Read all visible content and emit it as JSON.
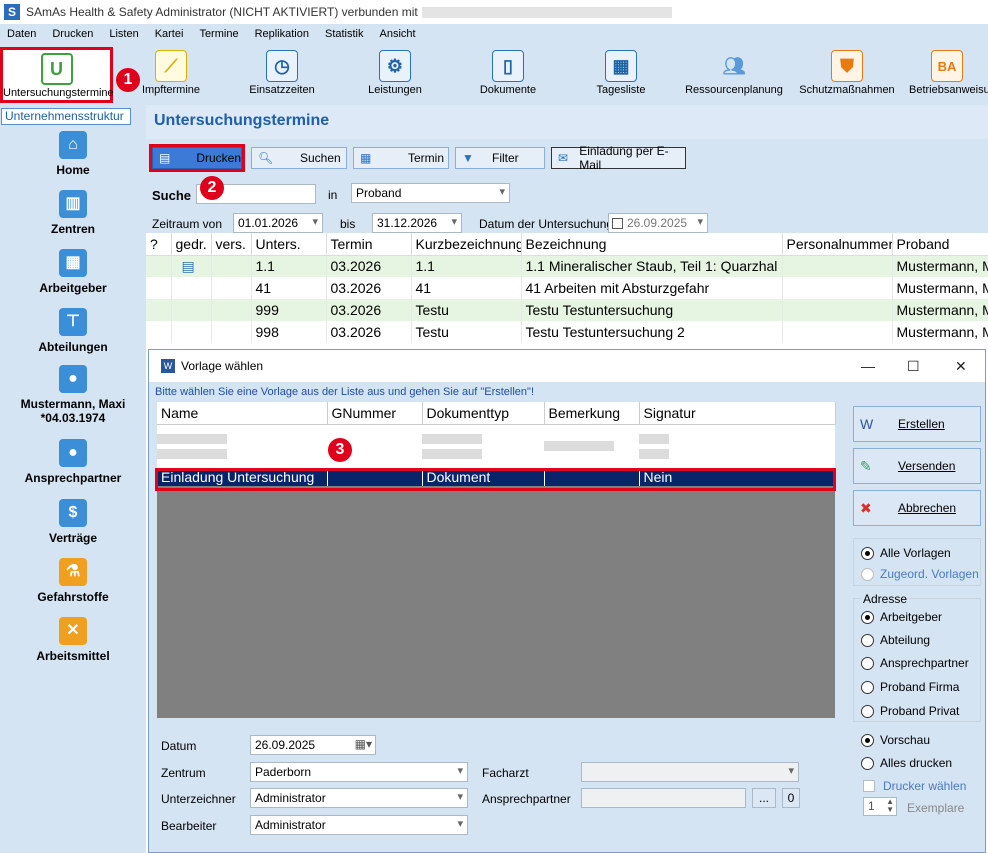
{
  "window": {
    "title": "SAmAs Health & Safety Administrator (NICHT AKTIVIERT)  verbunden mit",
    "app_icon": "S"
  },
  "menu": [
    "Daten",
    "Drucken",
    "Listen",
    "Kartei",
    "Termine",
    "Replikation",
    "Statistik",
    "Ansicht"
  ],
  "toolbar": [
    {
      "label": "Untersuchungstermine",
      "icon": "u-letter-icon"
    },
    {
      "label": "Impftermine",
      "icon": "syringe-icon"
    },
    {
      "label": "Einsatzzeiten",
      "icon": "calendar-clock-icon"
    },
    {
      "label": "Leistungen",
      "icon": "gear-clock-icon"
    },
    {
      "label": "Dokumente",
      "icon": "documents-icon"
    },
    {
      "label": "Tagesliste",
      "icon": "calendar-grid-icon"
    },
    {
      "label": "Ressourcenplanung",
      "icon": "people-icon"
    },
    {
      "label": "Schutzmaßnahmen",
      "icon": "helmet-shield-icon"
    },
    {
      "label": "Betriebsanweisung",
      "icon": "ba-document-icon"
    }
  ],
  "sidebar": {
    "tab": "Unternehmensstruktur",
    "items": [
      {
        "label": "Home"
      },
      {
        "label": "Zentren"
      },
      {
        "label": "Arbeitgeber"
      },
      {
        "label": "Abteilungen"
      },
      {
        "label": "Mustermann, Maxi",
        "sub": "*04.03.1974"
      },
      {
        "label": "Ansprechpartner"
      },
      {
        "label": "Verträge"
      },
      {
        "label": "Gefahrstoffe"
      },
      {
        "label": "Arbeitsmittel"
      }
    ]
  },
  "main": {
    "title": "Untersuchungstermine",
    "buttons": {
      "drucken": "Drucken",
      "suchen": "Suchen",
      "termin": "Termin",
      "filter": "Filter",
      "email": "Einladung per E-Mail"
    },
    "search": {
      "label": "Suche",
      "value": "",
      "in_label": "in",
      "in_value": "Proband"
    },
    "zeitraum": {
      "label": "Zeitraum von",
      "von": "01.01.2026",
      "bis_label": "bis",
      "bis": "31.12.2026",
      "datum_label": "Datum der Untersuchung",
      "datum": "26.09.2025"
    },
    "grid": {
      "columns": [
        "?",
        "gedr.",
        "vers.",
        "Unters.",
        "Termin",
        "Kurzbezeichnung",
        "Bezeichnung",
        "Personalnummer",
        "Proband"
      ],
      "rows": [
        {
          "q": "",
          "gedr": "printer",
          "vers": "",
          "unters": "1.1",
          "termin": "03.2026",
          "kurz": "1.1",
          "bez": "1.1 Mineralischer Staub, Teil 1: Quarzhal",
          "pers": "",
          "proband": "Mustermann, M"
        },
        {
          "q": "",
          "gedr": "",
          "vers": "",
          "unters": "41",
          "termin": "03.2026",
          "kurz": "41",
          "bez": "41 Arbeiten mit Absturzgefahr",
          "pers": "",
          "proband": "Mustermann, M"
        },
        {
          "q": "",
          "gedr": "",
          "vers": "",
          "unters": "999",
          "termin": "03.2026",
          "kurz": "Testu",
          "bez": "Testu Testuntersuchung",
          "pers": "",
          "proband": "Mustermann, M"
        },
        {
          "q": "",
          "gedr": "",
          "vers": "",
          "unters": "998",
          "termin": "03.2026",
          "kurz": "Testu",
          "bez": "Testu Testuntersuchung 2",
          "pers": "",
          "proband": "Mustermann, M"
        }
      ]
    }
  },
  "dialog": {
    "title": "Vorlage wählen",
    "hint": "Bitte wählen Sie eine Vorlage aus der Liste aus und gehen Sie auf \"Erstellen\"!",
    "columns": [
      "Name",
      "GNummer",
      "Dokumenttyp",
      "Bemerkung",
      "Signatur"
    ],
    "selected_row": {
      "name": "Einladung Untersuchung",
      "gnummer": "",
      "typ": "Dokument",
      "bemerkung": "",
      "signatur": "Nein"
    },
    "buttons": {
      "erstellen": "Erstellen",
      "versenden": "Versenden",
      "abbrechen": "Abbrechen"
    },
    "filter": {
      "alle": "Alle Vorlagen",
      "zugeord": "Zugeord. Vorlagen"
    },
    "adresse": {
      "label": "Adresse",
      "options": [
        "Arbeitgeber",
        "Abteilung",
        "Ansprechpartner",
        "Proband Firma",
        "Proband Privat"
      ]
    },
    "output": {
      "vorschau": "Vorschau",
      "alles": "Alles drucken",
      "drucker": "Drucker wählen",
      "exemplare_value": "1",
      "exemplare_label": "Exemplare"
    },
    "form": {
      "datum_label": "Datum",
      "datum": "26.09.2025",
      "zentrum_label": "Zentrum",
      "zentrum": "Paderborn",
      "unterzeichner_label": "Unterzeichner",
      "unterzeichner": "Administrator",
      "bearbeiter_label": "Bearbeiter",
      "bearbeiter": "Administrator",
      "facharzt_label": "Facharzt",
      "facharzt": "",
      "ansprechpartner_label": "Ansprechpartner",
      "ansprechpartner": "",
      "dots": "...",
      "count": "0"
    }
  },
  "badges": [
    "1",
    "2",
    "3"
  ],
  "colors": {
    "accent": "#1e5fa8",
    "highlight": "#e0001b",
    "selected_row": "#0a246a",
    "green_row": "#e6f5e1"
  }
}
